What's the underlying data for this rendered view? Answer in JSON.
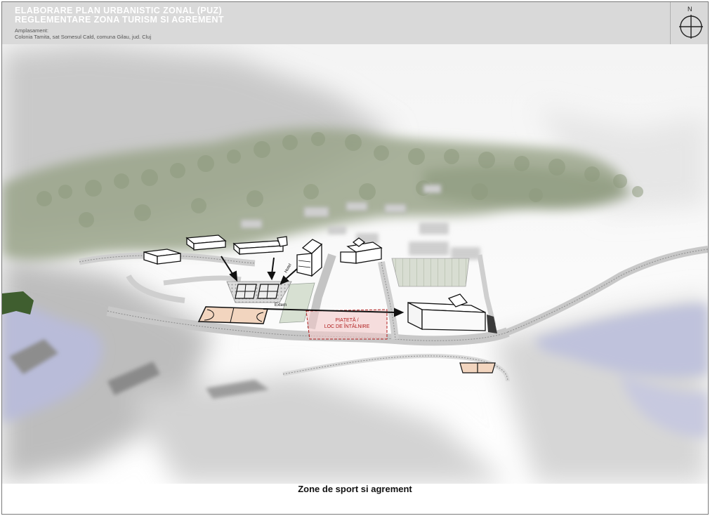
{
  "header": {
    "title_line1": "ELABORARE PLAN URBANISTIC ZONAL (PUZ)",
    "title_line2": "REGLEMENTARE ZONA TURISM SI AGREMENT",
    "location_label": "Amplasament:",
    "location_value": "Colonia Tamita, sat Somesul Cald, comuna Gilau, jud. Cluj"
  },
  "compass": {
    "north_label": "N"
  },
  "map_labels": {
    "hotel": "Hotel",
    "extern": "Extern",
    "plaza_line1": "PIAȚETĂ /",
    "plaza_line2": "LOC DE ÎNTÂLNIRE"
  },
  "caption": "Zone de sport si agrement",
  "colors": {
    "header_bg": "#d9d9d9",
    "water": "#b9bcd9",
    "forest": "#9aa58a",
    "plaza_fill": "#f3caca",
    "plaza_stroke": "#b02020",
    "court_fill": "#f2d5bf",
    "arrow": "#111111"
  }
}
